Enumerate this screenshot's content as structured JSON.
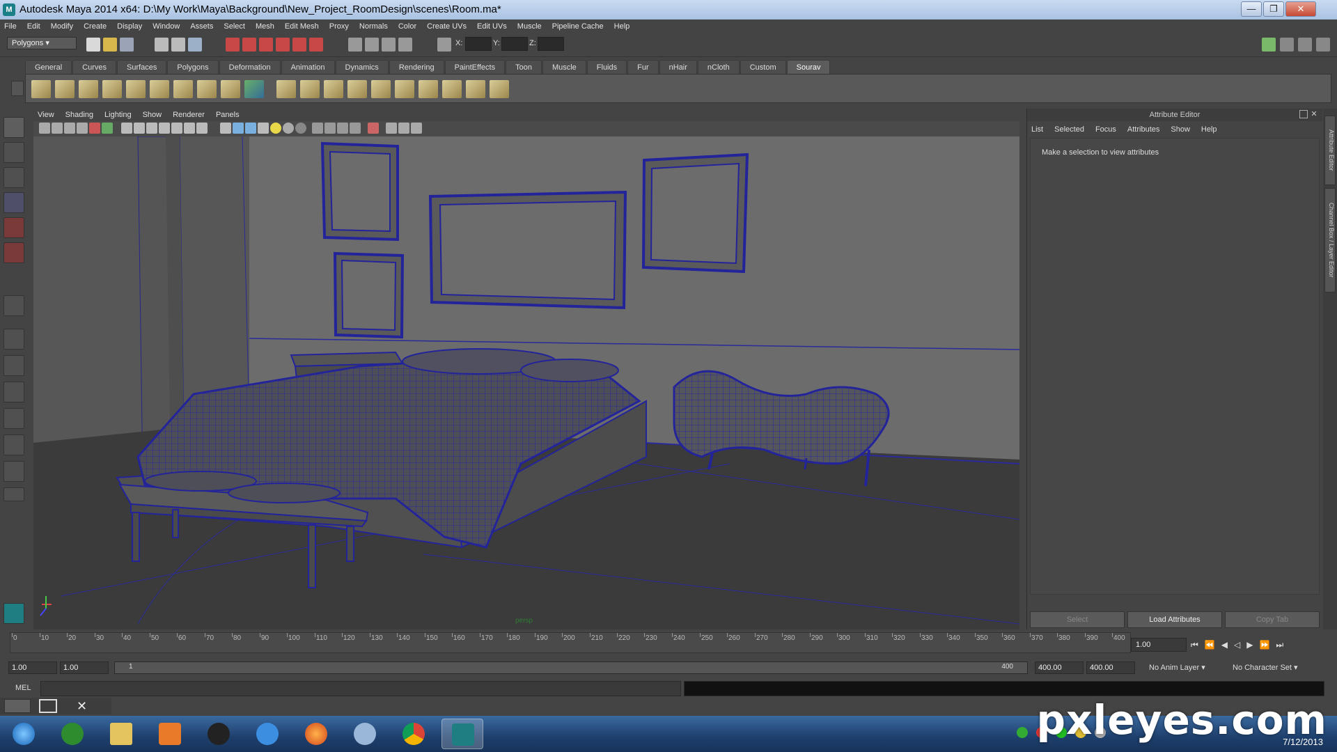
{
  "window": {
    "title": "Autodesk Maya 2014 x64: D:\\My Work\\Maya\\Background\\New_Project_RoomDesign\\scenes\\Room.ma*",
    "minimize": "—",
    "maximize": "❐",
    "close": "✕"
  },
  "menubar": [
    "File",
    "Edit",
    "Modify",
    "Create",
    "Display",
    "Window",
    "Assets",
    "Select",
    "Mesh",
    "Edit Mesh",
    "Proxy",
    "Normals",
    "Color",
    "Create UVs",
    "Edit UVs",
    "Muscle",
    "Pipeline Cache",
    "Help"
  ],
  "statusline": {
    "mode": "Polygons",
    "x_label": "X:",
    "y_label": "Y:",
    "z_label": "Z:"
  },
  "shelf_tabs": [
    "General",
    "Curves",
    "Surfaces",
    "Polygons",
    "Deformation",
    "Animation",
    "Dynamics",
    "Rendering",
    "PaintEffects",
    "Toon",
    "Muscle",
    "Fluids",
    "Fur",
    "nHair",
    "nCloth",
    "Custom",
    "Sourav"
  ],
  "shelf_active": "Sourav",
  "viewport": {
    "menu": [
      "View",
      "Shading",
      "Lighting",
      "Show",
      "Renderer",
      "Panels"
    ],
    "camera_label": "persp"
  },
  "attribute_editor": {
    "title": "Attribute Editor",
    "menu": [
      "List",
      "Selected",
      "Focus",
      "Attributes",
      "Show",
      "Help"
    ],
    "message": "Make a selection to view attributes",
    "select_button": "Select",
    "load_button": "Load Attributes",
    "copy_button": "Copy Tab"
  },
  "side_tabs": {
    "attr": "Attribute Editor",
    "channel": "Channel Box / Layer Editor"
  },
  "timeline": {
    "ticks": [
      0,
      10,
      20,
      30,
      40,
      50,
      60,
      70,
      80,
      90,
      100,
      110,
      120,
      130,
      140,
      150,
      160,
      170,
      180,
      190,
      200,
      210,
      220,
      230,
      240,
      250,
      260,
      270,
      280,
      290,
      300,
      310,
      320,
      330,
      340,
      350,
      360,
      370,
      380,
      390,
      400
    ],
    "current_frame": "1.00"
  },
  "range": {
    "start": "1.00",
    "current": "1.00",
    "slider_start": "1",
    "slider_end": "400",
    "end": "400.00",
    "end2": "400.00",
    "anim_layer": "No Anim Layer",
    "char_set": "No Character Set"
  },
  "cmdline": {
    "label": "MEL"
  },
  "taskbar": {
    "clock": "7/12/2013"
  },
  "watermark": "pxleyes.com"
}
